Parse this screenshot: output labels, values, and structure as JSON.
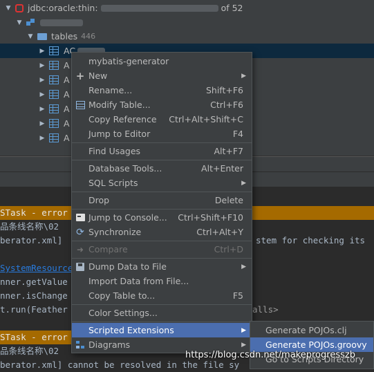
{
  "tree": {
    "connection_label": "jdbc:oracle:thin:",
    "connection_suffix": "of 52",
    "folder_label": "tables",
    "folder_count": "446",
    "selected_table_prefix": "AC",
    "table_prefixes": [
      "A",
      "A",
      "A",
      "A",
      "A",
      "A"
    ]
  },
  "console": {
    "lines": [
      "STask - error",
      "品条线名称\\02",
      "berator.xml]",
      "stem for checking its",
      "SystemResource",
      "nner.getValue",
      "nner.isChange",
      "t.run(Feather",
      "alls>",
      "STask - error",
      "品条线名称\\02",
      "berator.xml] cannot be resolved in the file sy"
    ]
  },
  "menu": {
    "items": [
      {
        "label": "mybatis-generator",
        "shortcut": "",
        "icon": "",
        "submenu": false
      },
      {
        "label": "New",
        "shortcut": "",
        "icon": "plus-icon",
        "submenu": true
      },
      {
        "label": "Rename...",
        "shortcut": "Shift+F6",
        "icon": "",
        "submenu": false
      },
      {
        "label": "Modify Table...",
        "shortcut": "Ctrl+F6",
        "icon": "table-icon",
        "submenu": false
      },
      {
        "label": "Copy Reference",
        "shortcut": "Ctrl+Alt+Shift+C",
        "icon": "",
        "submenu": false
      },
      {
        "label": "Jump to Editor",
        "shortcut": "F4",
        "icon": "",
        "submenu": false
      },
      {
        "label": "Find Usages",
        "shortcut": "Alt+F7",
        "icon": "",
        "submenu": false
      },
      {
        "label": "Database Tools...",
        "shortcut": "Alt+Enter",
        "icon": "",
        "submenu": false
      },
      {
        "label": "SQL Scripts",
        "shortcut": "",
        "icon": "",
        "submenu": true
      },
      {
        "label": "Drop",
        "shortcut": "Delete",
        "icon": "",
        "submenu": false
      },
      {
        "label": "Jump to Console...",
        "shortcut": "Ctrl+Shift+F10",
        "icon": "console-icon",
        "submenu": false
      },
      {
        "label": "Synchronize",
        "shortcut": "Ctrl+Alt+Y",
        "icon": "sync-icon",
        "submenu": false
      },
      {
        "label": "Compare",
        "shortcut": "Ctrl+D",
        "icon": "compare-icon",
        "submenu": false,
        "disabled": true
      },
      {
        "label": "Dump Data to File",
        "shortcut": "",
        "icon": "save-icon",
        "submenu": true
      },
      {
        "label": "Import Data from File...",
        "shortcut": "",
        "icon": "",
        "submenu": false
      },
      {
        "label": "Copy Table to...",
        "shortcut": "F5",
        "icon": "",
        "submenu": false
      },
      {
        "label": "Color Settings...",
        "shortcut": "",
        "icon": "",
        "submenu": false
      },
      {
        "label": "Scripted Extensions",
        "shortcut": "",
        "icon": "",
        "submenu": true,
        "highlighted": true
      },
      {
        "label": "Diagrams",
        "shortcut": "",
        "icon": "diagram-icon",
        "submenu": true
      }
    ]
  },
  "submenu": {
    "items": [
      {
        "label": "Generate POJOs.clj"
      },
      {
        "label": "Generate POJOs.groovy",
        "highlighted": true
      },
      {
        "label": "Go to Scripts Directory"
      }
    ]
  },
  "watermark": "https://blog.csdn.net/makeprogresszb",
  "colors": {
    "highlight": "#4b6eaf",
    "error_band": "#a56a00",
    "selected_row": "#0d293e"
  }
}
